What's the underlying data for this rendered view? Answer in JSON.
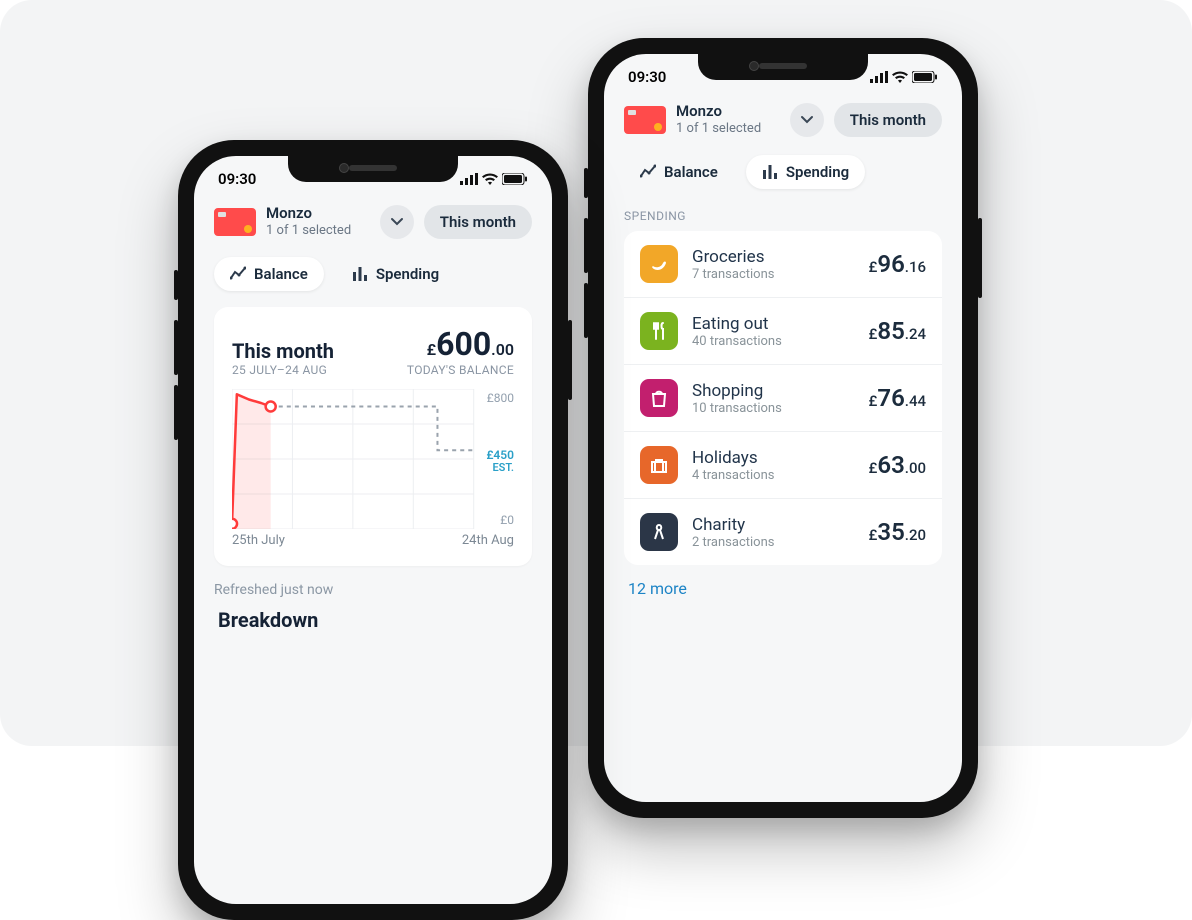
{
  "status": {
    "time": "09:30"
  },
  "account": {
    "name": "Monzo",
    "selected": "1 of 1 selected",
    "period_label": "This month"
  },
  "tabs": {
    "balance": "Balance",
    "spending": "Spending"
  },
  "balance_card": {
    "title": "This month",
    "range": "25 JULY–24 AUG",
    "currency": "£",
    "amount_major": "600",
    "amount_minor": ".00",
    "today_label": "TODAY'S BALANCE",
    "refreshed": "Refreshed just now",
    "breakdown": "Breakdown"
  },
  "chart_data": {
    "type": "line",
    "xlabel_start": "25th July",
    "xlabel_end": "24th Aug",
    "ylim": [
      0,
      800
    ],
    "ytick_top": "£800",
    "ytick_bottom": "£0",
    "estimate_label": "£450",
    "estimate_sub": "EST.",
    "actual": [
      {
        "x": 0.0,
        "y": 30
      },
      {
        "x": 0.02,
        "y": 770
      },
      {
        "x": 0.07,
        "y": 740
      },
      {
        "x": 0.12,
        "y": 720
      },
      {
        "x": 0.16,
        "y": 700
      }
    ],
    "projection": [
      {
        "x": 0.16,
        "y": 700
      },
      {
        "x": 0.85,
        "y": 700
      },
      {
        "x": 0.85,
        "y": 450
      },
      {
        "x": 1.0,
        "y": 450
      }
    ]
  },
  "spending": {
    "header": "SPENDING",
    "more": "12 more",
    "categories": [
      {
        "name": "Groceries",
        "tx": "7 transactions",
        "currency": "£",
        "maj": "96",
        "min": ".16",
        "color": "#f2a728",
        "icon": "banana"
      },
      {
        "name": "Eating out",
        "tx": "40 transactions",
        "currency": "£",
        "maj": "85",
        "min": ".24",
        "color": "#7bb31f",
        "icon": "utensils"
      },
      {
        "name": "Shopping",
        "tx": "10 transactions",
        "currency": "£",
        "maj": "76",
        "min": ".44",
        "color": "#c21f6e",
        "icon": "bag"
      },
      {
        "name": "Holidays",
        "tx": "4 transactions",
        "currency": "£",
        "maj": "63",
        "min": ".00",
        "color": "#e7672a",
        "icon": "suitcase"
      },
      {
        "name": "Charity",
        "tx": "2 transactions",
        "currency": "£",
        "maj": "35",
        "min": ".20",
        "color": "#2b3647",
        "icon": "ribbon"
      }
    ]
  }
}
